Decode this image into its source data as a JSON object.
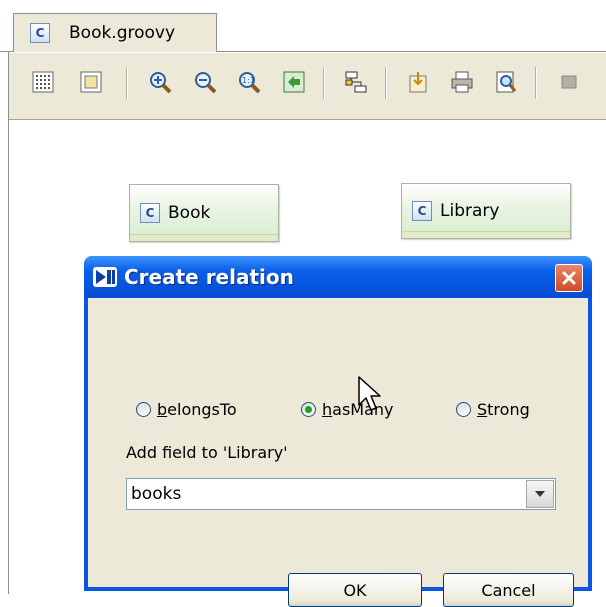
{
  "editor": {
    "tab_label": "Book.groovy",
    "tab_icon_letter": "C"
  },
  "toolbar": {
    "buttons": [
      {
        "name": "show-grid-icon"
      },
      {
        "name": "snap-to-grid-icon"
      },
      {
        "name": "zoom-in-icon"
      },
      {
        "name": "zoom-out-icon"
      },
      {
        "name": "actual-size-icon"
      },
      {
        "name": "fit-content-icon"
      },
      {
        "name": "layout-icon"
      },
      {
        "name": "export-icon"
      },
      {
        "name": "print-icon"
      },
      {
        "name": "print-preview-icon"
      },
      {
        "name": "properties-icon"
      }
    ]
  },
  "diagram": {
    "nodes": [
      {
        "label": "Book",
        "icon_letter": "C"
      },
      {
        "label": "Library",
        "icon_letter": "C"
      }
    ]
  },
  "dialog": {
    "title": "Create relation",
    "radios": [
      {
        "mnemonic": "b",
        "rest": "elongsTo",
        "selected": false
      },
      {
        "mnemonic": "h",
        "rest": "asMany",
        "selected": true
      },
      {
        "mnemonic": "S",
        "rest": "trong",
        "selected": false
      }
    ],
    "field_label": "Add field to 'Library'",
    "field_value": "books",
    "ok_label": "OK",
    "cancel_label": "Cancel"
  },
  "colors": {
    "titlebar": "#0a55e3",
    "window_face": "#ece9d8",
    "close_button": "#d24a25",
    "node_fill": "#eaf4e4"
  }
}
